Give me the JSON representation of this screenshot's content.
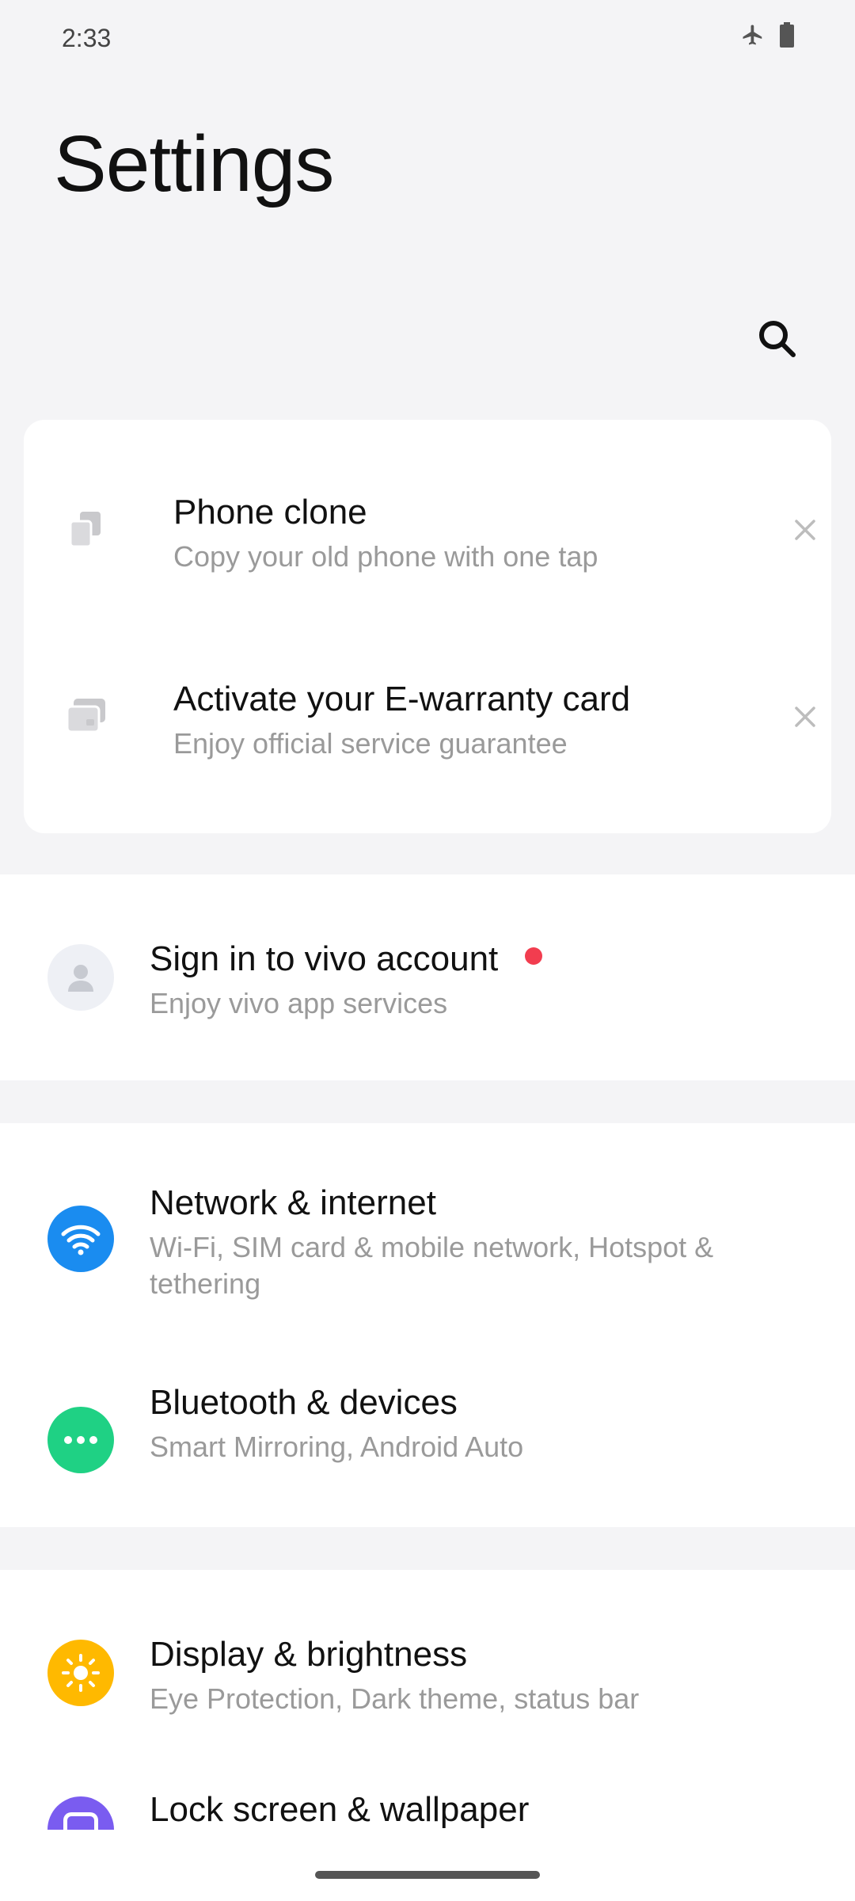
{
  "status_bar": {
    "time": "2:33"
  },
  "header": {
    "title": "Settings"
  },
  "suggestions": [
    {
      "title": "Phone clone",
      "subtitle": "Copy your old phone with one tap"
    },
    {
      "title": "Activate your E-warranty card",
      "subtitle": "Enjoy official service guarantee"
    }
  ],
  "account": {
    "title": "Sign in to vivo account",
    "subtitle": "Enjoy vivo app services"
  },
  "connectivity": [
    {
      "title": "Network & internet",
      "subtitle": "Wi-Fi, SIM card & mobile network, Hotspot & tethering"
    },
    {
      "title": "Bluetooth & devices",
      "subtitle": "Smart Mirroring, Android Auto"
    }
  ],
  "personalization": [
    {
      "title": "Display & brightness",
      "subtitle": "Eye Protection, Dark theme, status bar"
    },
    {
      "title": "Lock screen & wallpaper",
      "subtitle": ""
    }
  ],
  "colors": {
    "network_icon_bg": "#1a8cf0",
    "bluetooth_icon_bg": "#1fd184",
    "display_icon_bg": "#ffb900",
    "lockscreen_icon_bg": "#7a5cf0",
    "notification_dot": "#f23d4f"
  },
  "icons": {
    "search": "search-icon",
    "phone_clone": "phone-clone-icon",
    "warranty": "warranty-card-icon",
    "close": "close-icon",
    "account": "account-avatar-icon",
    "network": "wifi-icon",
    "bluetooth": "bluetooth-devices-icon",
    "display": "sun-icon",
    "lockscreen": "lock-screen-icon"
  }
}
